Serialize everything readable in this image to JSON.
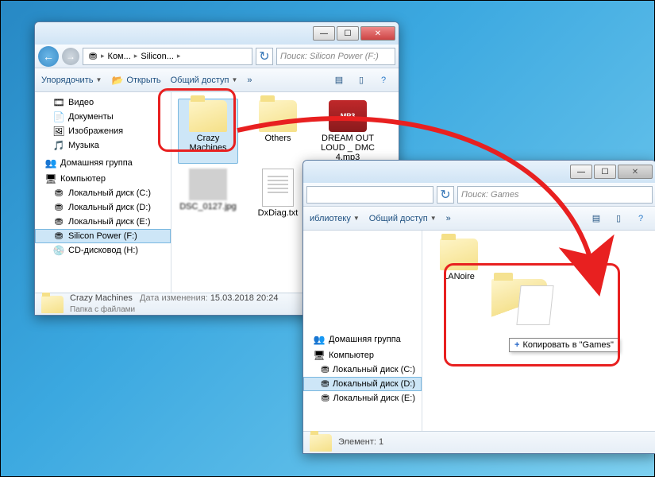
{
  "window1": {
    "breadcrumb": [
      "Ком...",
      "Silicon..."
    ],
    "search_placeholder": "Поиск: Silicon Power (F:)",
    "toolbar": {
      "organize": "Упорядочить",
      "open": "Открыть",
      "share": "Общий доступ",
      "more": "»"
    },
    "sidebar": {
      "video": "Видео",
      "documents": "Документы",
      "images": "Изображения",
      "music": "Музыка",
      "homegroup": "Домашняя группа",
      "computer": "Компьютер",
      "drive_c": "Локальный диск (C:)",
      "drive_d": "Локальный диск (D:)",
      "drive_e": "Локальный диск (E:)",
      "drive_f": "Silicon Power (F:)",
      "drive_h": "CD-дисковод (H:)"
    },
    "items": {
      "crazy": "Crazy Machines",
      "others": "Others",
      "dream": "DREAM OUT LOUD _ DMC 4.mp3",
      "jpg": "DSC_0127.jpg",
      "dxdiag": "DxDiag.txt"
    },
    "status": {
      "name": "Crazy Machines",
      "date_label": "Дата изменения:",
      "date_value": "15.03.2018 20:24",
      "type": "Папка с файлами"
    }
  },
  "window2": {
    "search_placeholder": "Поиск: Games",
    "toolbar": {
      "library": "иблиотеку",
      "share": "Общий доступ",
      "more": "»"
    },
    "sidebar": {
      "homegroup": "Домашняя группа",
      "computer": "Компьютер",
      "drive_c": "Локальный диск (C:)",
      "drive_d": "Локальный диск (D:)",
      "drive_e": "Локальный диск (E:)"
    },
    "items": {
      "lanoire": "LANoire"
    },
    "status": {
      "label": "Элемент: 1"
    }
  },
  "tooltip": {
    "plus": "+",
    "text": "Копировать в \"Games\""
  },
  "icons": {
    "back": "←",
    "fwd": "→",
    "refresh": "↻",
    "down": "▼",
    "right": "▸",
    "help": "?",
    "mp3": "MP3"
  }
}
